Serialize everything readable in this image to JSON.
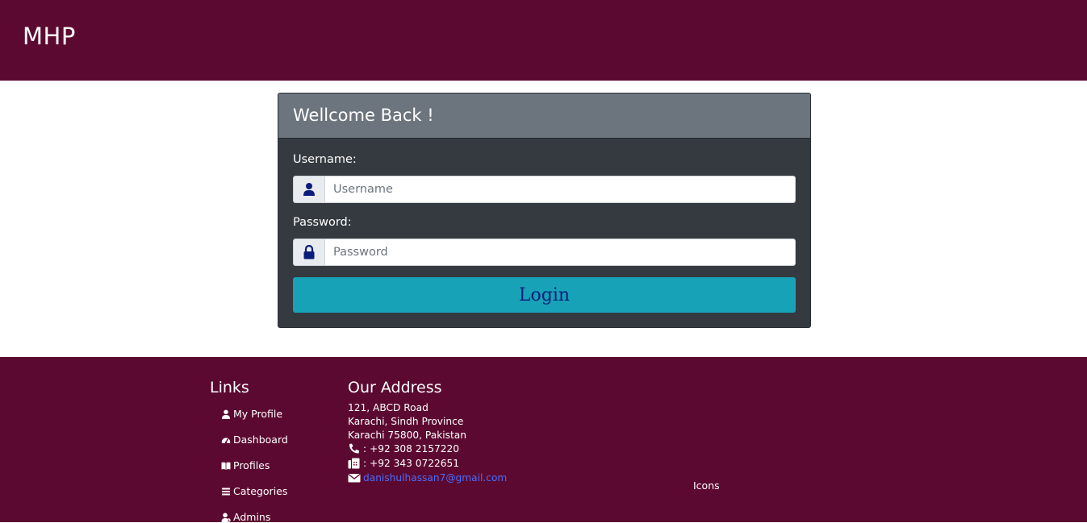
{
  "header": {
    "brand": "MHP"
  },
  "login": {
    "title": "Wellcome Back !",
    "username_label": "Username:",
    "username_placeholder": "Username",
    "password_label": "Password:",
    "password_placeholder": "Password",
    "login_label": "Login"
  },
  "footer": {
    "links_title": "Links",
    "links": [
      {
        "label": "My Profile",
        "icon": "user-icon"
      },
      {
        "label": "Dashboard",
        "icon": "tachometer-icon"
      },
      {
        "label": "Profiles",
        "icon": "book-icon"
      },
      {
        "label": "Categories",
        "icon": "list-icon"
      },
      {
        "label": "Admins",
        "icon": "user-cog-icon"
      }
    ],
    "address_title": "Our Address",
    "address": [
      "121, ABCD Road",
      "Karachi, Sindh Province",
      "Karachi 75800, Pakistan"
    ],
    "phone": ": +92 308 2157220",
    "fax": ": +92 343 0722651",
    "email": "danishulhassan7@gmail.com",
    "icons_label": "Icons"
  },
  "colors": {
    "brand": "#5c0931",
    "card": "#343a40",
    "card_header": "#6c757d",
    "button": "#17a2b8",
    "icon": "#0b1d7a"
  }
}
